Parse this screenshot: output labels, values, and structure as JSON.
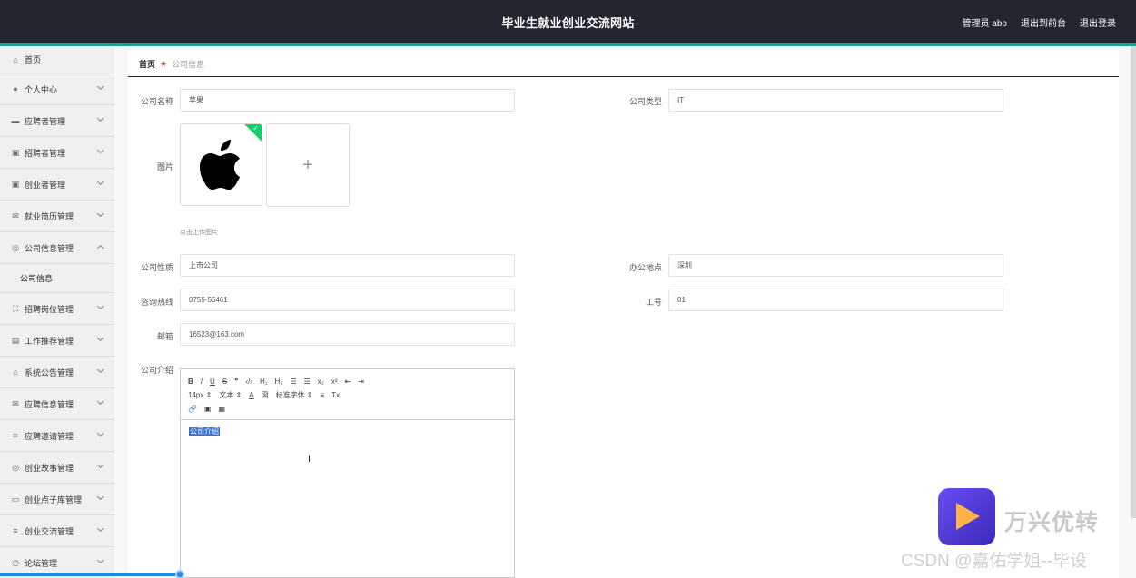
{
  "header": {
    "title": "毕业生就业创业交流网站",
    "nav": [
      "管理员 abo",
      "退出到前台",
      "退出登录"
    ]
  },
  "sidebar": {
    "items": [
      {
        "label": "首页",
        "icon": "home-icon",
        "chevron": false
      },
      {
        "label": "个人中心",
        "icon": "user-icon",
        "chevron": true
      },
      {
        "label": "应聘者管理",
        "icon": "monitor-icon",
        "chevron": true
      },
      {
        "label": "招聘者管理",
        "icon": "briefcase-icon",
        "chevron": true
      },
      {
        "label": "创业者管理",
        "icon": "briefcase-icon",
        "chevron": true
      },
      {
        "label": "就业简历管理",
        "icon": "mail-icon",
        "chevron": true
      },
      {
        "label": "公司信息管理",
        "icon": "compass-icon",
        "chevron": true,
        "expanded": true,
        "children": [
          "公司信息"
        ]
      },
      {
        "label": "招聘岗位管理",
        "icon": "expand-icon",
        "chevron": true
      },
      {
        "label": "工作推荐管理",
        "icon": "clipboard-icon",
        "chevron": true
      },
      {
        "label": "系统公告管理",
        "icon": "bank-icon",
        "chevron": true
      },
      {
        "label": "应聘信息管理",
        "icon": "envelope-icon",
        "chevron": true
      },
      {
        "label": "应聘邀请管理",
        "icon": "crop-icon",
        "chevron": true
      },
      {
        "label": "创业故事管理",
        "icon": "compass-icon",
        "chevron": true
      },
      {
        "label": "创业点子库管理",
        "icon": "chat-icon",
        "chevron": true
      },
      {
        "label": "创业交流管理",
        "icon": "menu-icon",
        "chevron": true
      },
      {
        "label": "论坛管理",
        "icon": "clock-icon",
        "chevron": true
      }
    ]
  },
  "breadcrumb": {
    "home": "首页",
    "current": "公司信息"
  },
  "form": {
    "company_name_label": "公司名称",
    "company_name": "苹果",
    "company_type_label": "公司类型",
    "company_type": "IT",
    "image_label": "图片",
    "upload_tip": "点击上传图片",
    "nature_label": "公司性质",
    "nature": "上市公司",
    "location_label": "办公地点",
    "location": "深圳",
    "hotline_label": "咨询热线",
    "hotline": "0755-56461",
    "job_no_label": "工号",
    "job_no": "01",
    "email_label": "邮箱",
    "email": "16523@163.com",
    "intro_label": "公司介绍",
    "intro_text": "公司介绍"
  },
  "editor": {
    "row1": [
      "B",
      "I",
      "U",
      "S",
      "❞",
      "‹/›",
      "H₁",
      "H₂",
      "☰",
      "☰",
      "x₂",
      "x²",
      "⇤",
      "⇥"
    ],
    "font_size": "14px",
    "text_style": "文本",
    "font_family": "标准字体",
    "color_btn": "A",
    "bg_btn": "図",
    "align_btn": "≡",
    "clear_btn": "Tx"
  },
  "watermark": {
    "brand": "万兴优转",
    "csdn": "CSDN @嘉佑学姐--毕设"
  }
}
